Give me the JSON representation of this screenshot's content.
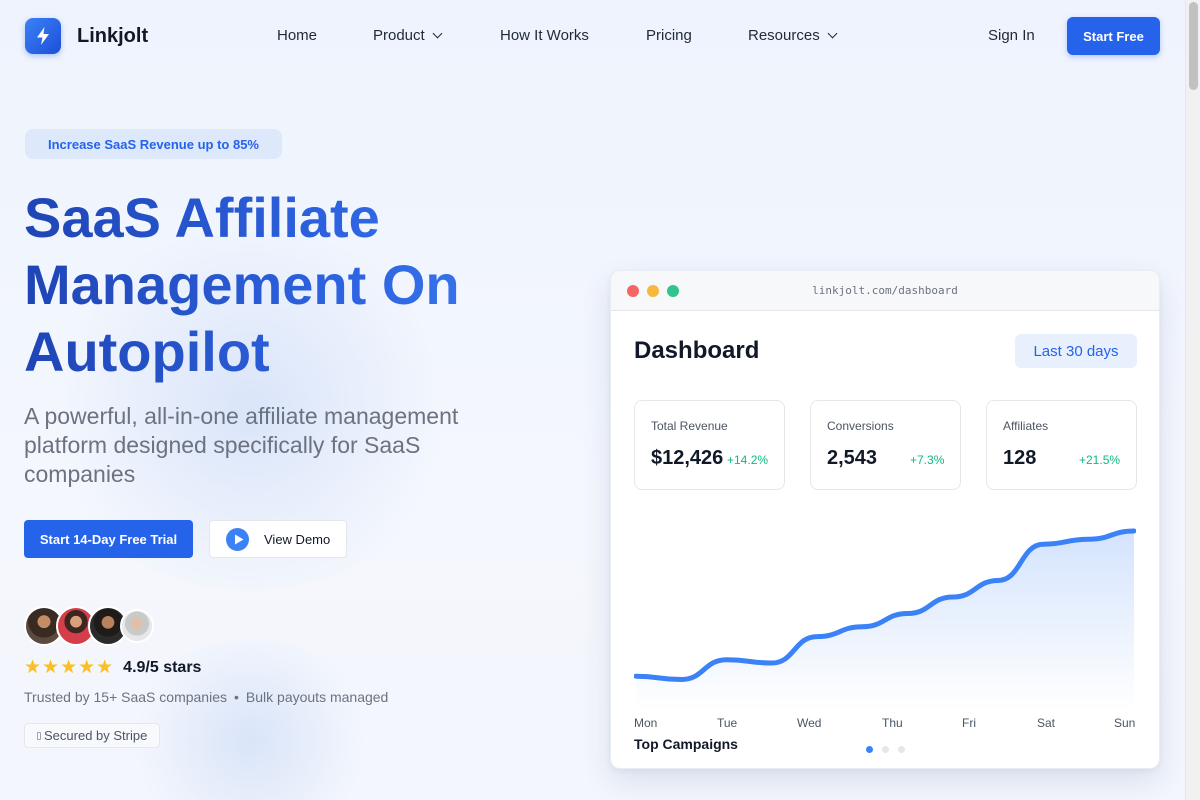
{
  "brand": {
    "name": "Linkjolt",
    "logo_icon": "lightning-bolt-icon",
    "accent_color": "#2563eb"
  },
  "nav": {
    "home": "Home",
    "product": "Product",
    "how_it_works": "How It Works",
    "pricing": "Pricing",
    "resources": "Resources"
  },
  "header_actions": {
    "sign_in": "Sign In",
    "start_free": "Start Free"
  },
  "hero": {
    "badge": "Increase SaaS Revenue up to 85%",
    "title_line1": "SaaS Affiliate",
    "title_line2": "Management On",
    "title_line3": "Autopilot",
    "subtitle": "A powerful, all-in-one affiliate management platform designed specifically for SaaS companies",
    "cta_primary": "Start 14-Day Free Trial",
    "cta_secondary": "View Demo",
    "rating_stars": 5,
    "rating_text": "4.9/5 stars",
    "stars_glyphs": "★★★★★",
    "trusted_by": "Trusted by 15+ SaaS companies",
    "bullet": "•",
    "payouts": "Bulk payouts managed",
    "secured": "Secured by Stripe"
  },
  "dashboard": {
    "url": "linkjolt.com/dashboard",
    "title": "Dashboard",
    "range": "Last 30 days",
    "stats": [
      {
        "label": "Total Revenue",
        "value": "$12,426",
        "delta": "+14.2%"
      },
      {
        "label": "Conversions",
        "value": "2,543",
        "delta": "+7.3%"
      },
      {
        "label": "Affiliates",
        "value": "128",
        "delta": "+21.5%"
      }
    ],
    "chart": {
      "days": [
        "Mon",
        "Tue",
        "Wed",
        "Thu",
        "Fri",
        "Sat",
        "Sun"
      ],
      "trend": [
        0.12,
        0.1,
        0.22,
        0.2,
        0.36,
        0.42,
        0.5,
        0.6,
        0.7,
        0.92,
        0.95,
        1.0
      ],
      "line_color": "#3b82f6"
    },
    "section_title": "Top Campaigns",
    "carousel_pages": 3,
    "carousel_active": 0
  }
}
